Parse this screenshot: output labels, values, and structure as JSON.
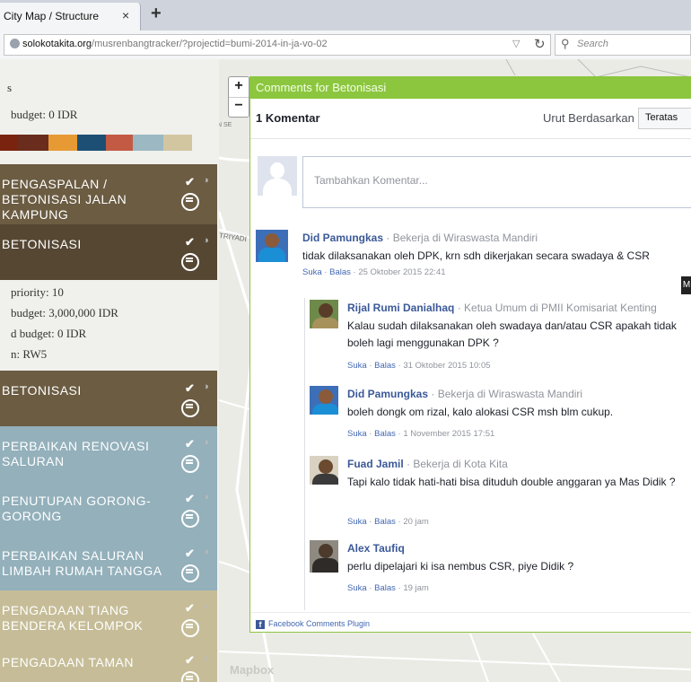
{
  "browser": {
    "tab_title": "City Map / Structure",
    "tab_close": "×",
    "new_tab": "+",
    "url_host": "solokotakita.org",
    "url_path": "/musrenbangtracker/?projectid=bumi-2014-in-ja-vo-02",
    "search_placeholder": "Search"
  },
  "map": {
    "zoom_in": "+",
    "zoom_out": "−",
    "label_road": "TRIYADI",
    "label_road2": "N SE",
    "attribution": "Mapbox"
  },
  "panel": {
    "top_line": "s",
    "budget_line": "budget: 0 IDR",
    "swatches": [
      "#7a2410",
      "#6a2c1d",
      "#e79a33",
      "#1d4f74",
      "#c35a44",
      "#9bb8c3",
      "#d2c6a1"
    ],
    "items": [
      {
        "label": "PENGASPALAN / BETONISASI JALAN KAMPUNG",
        "color": "#6b5c42"
      },
      {
        "label": "BETONISASI",
        "color": "#564733"
      },
      {
        "label": "BETONISASI",
        "color": "#6b5c42"
      },
      {
        "label": "PERBAIKAN RENOVASI SALURAN",
        "color": "#93b0bb"
      },
      {
        "label": "PENUTUPAN GORONG-GORONG",
        "color": "#93b0bb"
      },
      {
        "label": "PERBAIKAN SALURAN LIMBAH RUMAH TANGGA",
        "color": "#93b0bb"
      },
      {
        "label": "PENGADAAN TIANG BENDERA KELOMPOK",
        "color": "#c6bd98"
      },
      {
        "label": "PENGADAAN TAMAN",
        "color": "#c6bd98"
      }
    ],
    "details": {
      "priority": "priority: 10",
      "budget": "budget: 3,000,000 IDR",
      "used_budget": "d budget: 0 IDR",
      "location": "n: RW5"
    },
    "check_glyph": "✔",
    "dot_glyph": "◑"
  },
  "dialog": {
    "title": "Comments for Betonisasi",
    "count": "1 Komentar",
    "sort_label": "Urut Berdasarkan",
    "sort_value": "Teratas",
    "input_placeholder": "Tambahkan Komentar...",
    "footer": "Facebook Comments Plugin",
    "more_tag": "M",
    "like": "Suka",
    "reply": "Balas",
    "comments": [
      {
        "name": "Did Pamungkas",
        "role": " · Bekerja di Wiraswasta Mandiri",
        "text": "tidak dilaksanakan oleh DPK, krn sdh dikerjakan secara swadaya & CSR",
        "time": "25 Oktober 2015 22:41",
        "av_bg": "#3d6fb8",
        "av_head": "#8a5a3a",
        "av_body": "#1b8fd6"
      },
      {
        "name": "Rijal Rumi Danialhaq",
        "role": " · Ketua Umum di PMII Komisariat Kenting",
        "text": "Kalau sudah dilaksanakan oleh swadaya dan/atau CSR apakah tidak boleh lagi menggunakan DPK ?",
        "time": "31 Oktober 2015 10:05",
        "av_bg": "#6e8a4a",
        "av_head": "#5a3d28",
        "av_body": "#a8925c"
      },
      {
        "name": "Did Pamungkas",
        "role": " · Bekerja di Wiraswasta Mandiri",
        "text": "boleh dongk om rizal, kalo alokasi CSR msh blm cukup.",
        "time": "1 November 2015 17:51",
        "av_bg": "#3d6fb8",
        "av_head": "#8a5a3a",
        "av_body": "#1b8fd6"
      },
      {
        "name": "Fuad Jamil",
        "role": " · Bekerja di Kota Kita",
        "text": "Tapi kalo tidak hati-hati bisa dituduh double anggaran ya Mas Didik ?",
        "time": "20 jam",
        "av_bg": "#d9d2c2",
        "av_head": "#6b4a30",
        "av_body": "#3a3a3a"
      },
      {
        "name": "Alex Taufiq",
        "role": "",
        "text": "perlu dipelajari ki isa nembus CSR, piye Didik ?",
        "time": "19 jam",
        "av_bg": "#8e8a82",
        "av_head": "#4c3a2c",
        "av_body": "#2f2b28"
      }
    ]
  }
}
